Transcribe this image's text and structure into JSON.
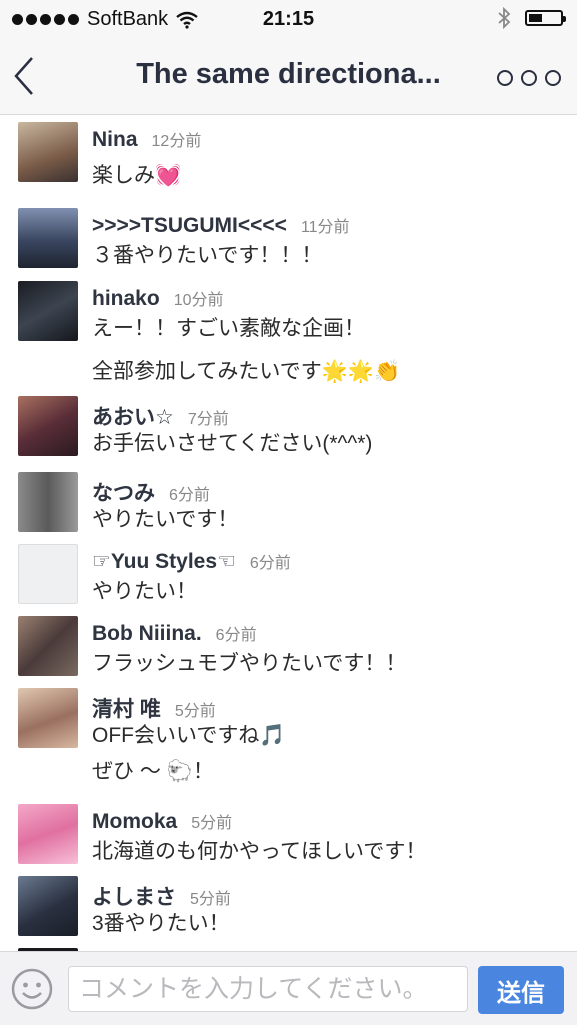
{
  "status_bar": {
    "carrier": "SoftBank",
    "time": "21:15",
    "signal_icon": "signal-dots-icon",
    "wifi_icon": "wifi-icon",
    "bluetooth_icon": "bluetooth-icon",
    "battery_icon": "battery-icon"
  },
  "nav": {
    "title": "The same directiona...",
    "back_icon": "chevron-left-icon",
    "more_icon": "more-circles-icon"
  },
  "messages": [
    {
      "name": "Nina",
      "time": "12分前",
      "lines": [
        "楽しみ💓"
      ],
      "avatar_color": "#8a7060"
    },
    {
      "name": ">>>>TSUGUMI<<<<",
      "time": "11分前",
      "lines": [
        "３番やりたいです！！！"
      ],
      "avatar_color": "#4a5a7a"
    },
    {
      "name": "hinako",
      "time": "10分前",
      "lines": [
        "えー！！すごい素敵な企画！",
        "全部参加してみたいです🌟🌟👏"
      ],
      "avatar_color": "#2a2e36"
    },
    {
      "name": "あおい☆",
      "time": "7分前",
      "lines": [
        "お手伝いさせてください(*^^*)"
      ],
      "avatar_color": "#6a3a48"
    },
    {
      "name": "なつみ",
      "time": "6分前",
      "lines": [
        "やりたいです！"
      ],
      "avatar_color": "#6c6c6c"
    },
    {
      "name": "☞Yuu Styles☜",
      "time": "6分前",
      "lines": [
        "やりたい！"
      ],
      "avatar_color": "#e8e8ea"
    },
    {
      "name": "Bob Niiina.",
      "time": "6分前",
      "lines": [
        "フラッシュモブやりたいです！！"
      ],
      "avatar_color": "#5a4a4a"
    },
    {
      "name": "清村 唯",
      "time": "5分前",
      "lines": [
        "OFF会いいですね🎵",
        "ぜひ 〜 🐑！"
      ],
      "avatar_color": "#c8a890"
    },
    {
      "name": "Momoka",
      "time": "5分前",
      "lines": [
        "北海道のも何かやってほしいです！"
      ],
      "avatar_color": "#e890b8"
    },
    {
      "name": "よしまさ",
      "time": "5分前",
      "lines": [
        "3番やりたい！"
      ],
      "avatar_color": "#2e3440"
    }
  ],
  "input": {
    "placeholder": "コメントを入力してください。",
    "send_label": "送信",
    "emoji_icon": "smiley-icon"
  },
  "colors": {
    "accent": "#4a86e0",
    "bar_bg": "#f7f7f8",
    "name_text": "#2e3440",
    "time_text": "#888888"
  }
}
